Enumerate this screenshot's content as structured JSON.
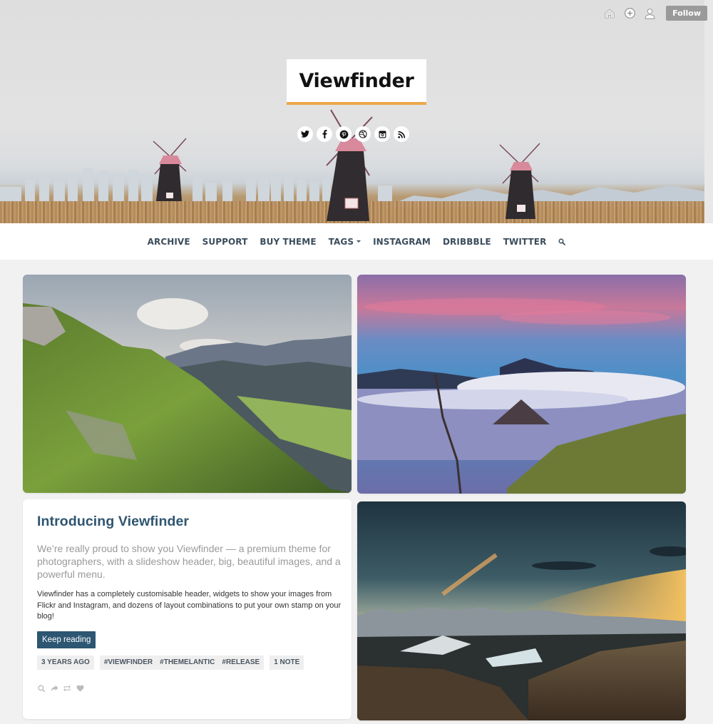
{
  "topbar": {
    "icons": [
      "home-icon",
      "compose-icon",
      "account-icon"
    ],
    "follow_label": "Follow"
  },
  "header": {
    "site_title": "Viewfinder",
    "accent_color": "#eca84c",
    "social_icons": [
      "twitter-icon",
      "facebook-icon",
      "pinterest-icon",
      "dribbble-icon",
      "instagram-icon",
      "rss-icon"
    ]
  },
  "nav": {
    "items": [
      {
        "label": "ARCHIVE"
      },
      {
        "label": "SUPPORT"
      },
      {
        "label": "BUY THEME"
      },
      {
        "label": "TAGS",
        "dropdown": true
      },
      {
        "label": "INSTAGRAM"
      },
      {
        "label": "DRIBBBLE"
      },
      {
        "label": "TWITTER"
      }
    ],
    "search_icon": "search-icon",
    "text_color": "#3b4d5c"
  },
  "posts": {
    "photos": [
      {
        "name": "alpine-valley-photo"
      },
      {
        "name": "volcano-sunrise-photo"
      },
      {
        "name": "mountain-sunset-photo"
      }
    ],
    "text_post": {
      "title": "Introducing Viewfinder",
      "lead": "We’re really proud to show you Viewfinder — a premium theme for photographers, with a slideshow header, big, beautiful images, and a powerful menu.",
      "body": "Viewfinder has a completely customisable header, widgets to show your images from Flickr and Instagram, and dozens of layout combinations to put your own stamp on your blog!",
      "button_label": "Keep reading",
      "button_color": "#2c5672",
      "timestamp": "3 YEARS AGO",
      "tags": [
        "#VIEWFINDER",
        "#THEMELANTIC",
        "#RELEASE"
      ],
      "notes": "1 NOTE",
      "action_icons": [
        "search-icon",
        "share-icon",
        "reblog-icon",
        "like-icon"
      ]
    }
  }
}
